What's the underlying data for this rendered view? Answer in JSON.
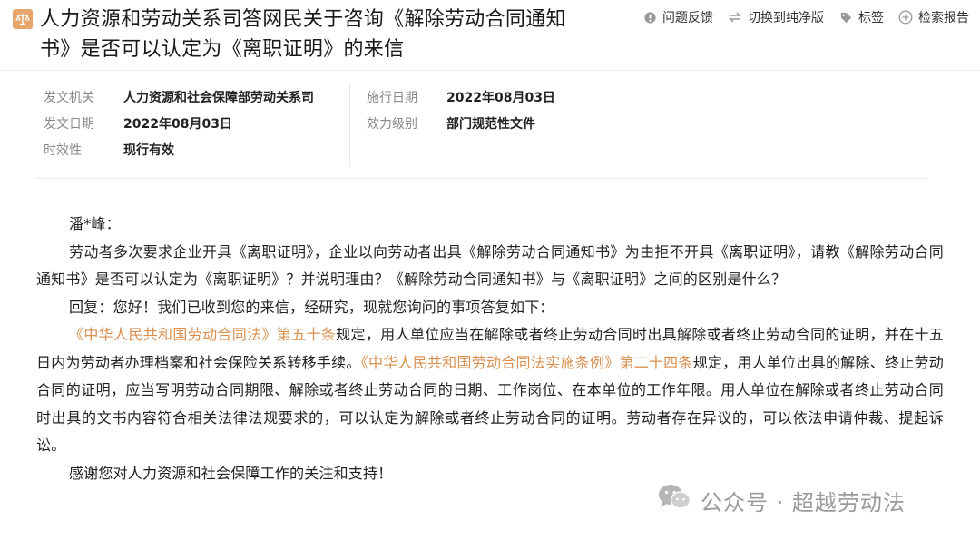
{
  "header": {
    "title": "人力资源和劳动关系司答网民关于咨询《解除劳动合同通知书》是否可以认定为《离职证明》的来信",
    "toolbar": {
      "feedback": "问题反馈",
      "switch_clean": "切换到纯净版",
      "tag": "标签",
      "search_report": "检索报告"
    }
  },
  "meta": {
    "issuer_label": "发文机关",
    "issuer_value": "人力资源和社会保障部劳动关系司",
    "issue_date_label": "发文日期",
    "issue_date_value": "2022年08月03日",
    "validity_label": "时效性",
    "validity_value": "现行有效",
    "effective_date_label": "施行日期",
    "effective_date_value": "2022年08月03日",
    "level_label": "效力级别",
    "level_value": "部门规范性文件"
  },
  "body": {
    "greeting": "潘*峰：",
    "question": "劳动者多次要求企业开具《离职证明》，企业以向劳动者出具《解除劳动合同通知书》为由拒不开具《离职证明》，请教《解除劳动合同通知书》是否可以认定为《离职证明》？并说明理由？《解除劳动合同通知书》与《离职证明》之间的区别是什么？",
    "reply_intro": "回复：您好！我们已收到您的来信，经研究，现就您询问的事项答复如下：",
    "law1_link": "《中华人民共和国劳动合同法》第五十条",
    "law1_text": "规定，用人单位应当在解除或者终止劳动合同时出具解除或者终止劳动合同的证明，并在十五日内为劳动者办理档案和社会保险关系转移手续。",
    "law2_link": "《中华人民共和国劳动合同法实施条例》第二十四条",
    "law2_text": "规定，用人单位出具的解除、终止劳动合同的证明，应当写明劳动合同期限、解除或者终止劳动合同的日期、工作岗位、在本单位的工作年限。用人单位在解除或者终止劳动合同时出具的文书内容符合相关法律法规要求的，可以认定为解除或者终止劳动合同的证明。劳动者存在异议的，可以依法申请仲裁、提起诉讼。",
    "thanks": "感谢您对人力资源和社会保障工作的关注和支持！"
  },
  "watermark": {
    "text": "公众号 · 超越劳动法"
  },
  "colors": {
    "accent": "#d9904f",
    "icon_bg": "#e5a56b",
    "label_gray": "#8a8a8a"
  }
}
